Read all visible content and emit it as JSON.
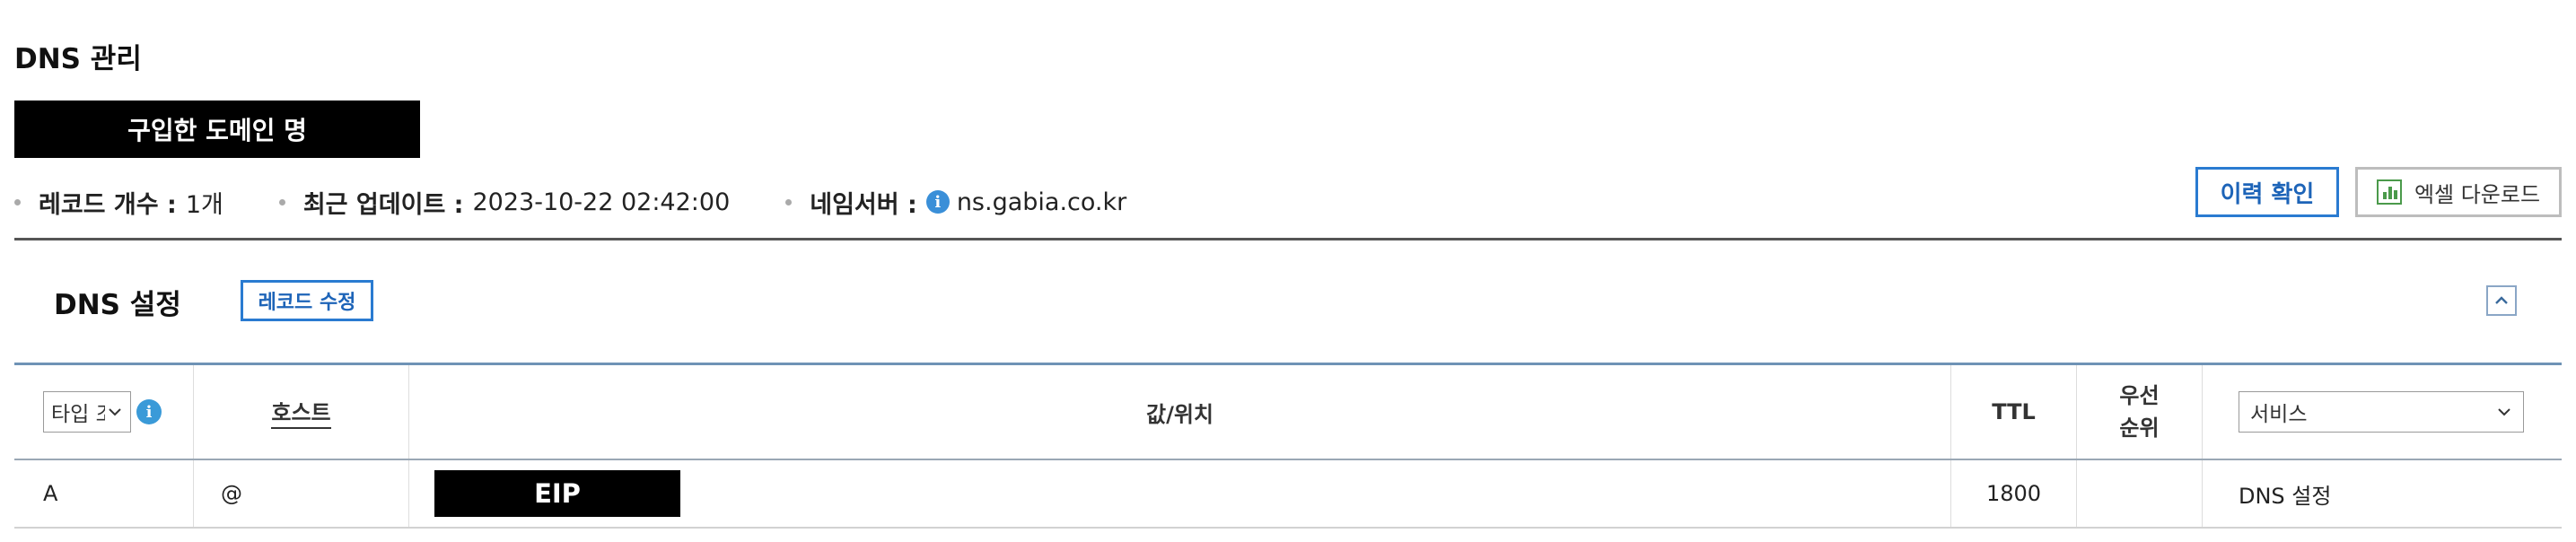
{
  "page": {
    "title": "DNS 관리"
  },
  "domain": {
    "label": "구입한 도메인 명"
  },
  "summary": {
    "record_count_label": "레코드 개수 :",
    "record_count_value": "1개",
    "updated_label": "최근 업데이트 :",
    "updated_value": "2023-10-22 02:42:00",
    "nameserver_label": "네임서버 :",
    "nameserver_value": "ns.gabia.co.kr"
  },
  "toolbar": {
    "history_label": "이력 확인",
    "excel_label": "엑셀 다운로드"
  },
  "section": {
    "title": "DNS 설정",
    "edit_label": "레코드 수정"
  },
  "table": {
    "headers": {
      "type_select": "타입 조",
      "host": "호스트",
      "value": "값/위치",
      "ttl": "TTL",
      "priority_line1": "우선",
      "priority_line2": "순위",
      "service_select": "서비스"
    },
    "rows": [
      {
        "type": "A",
        "host": "@",
        "value": "EIP",
        "ttl": "1800",
        "priority": "",
        "service": "DNS 설정"
      }
    ]
  },
  "icons": {
    "info": "info-icon",
    "excel": "spreadsheet-chart-icon",
    "collapse": "chevron-up-icon",
    "dropdown": "chevron-down-icon"
  },
  "colors": {
    "accent_blue": "#2a7bd1",
    "info_blue": "#3a8fd8",
    "excel_green": "#4b9a4b",
    "mask_black": "#000000"
  }
}
